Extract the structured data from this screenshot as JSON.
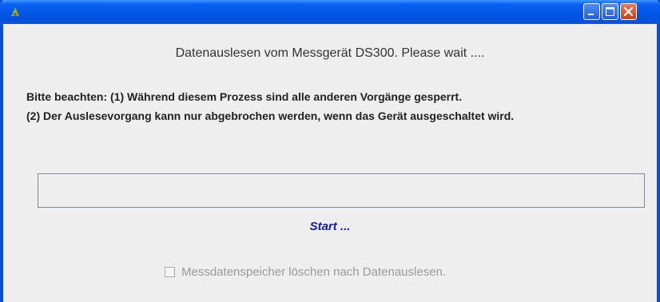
{
  "window": {
    "title": "",
    "icon": "java-app-icon",
    "controls": [
      "minimize-icon",
      "maximize-icon",
      "close-icon"
    ]
  },
  "dialog": {
    "message": "Datenauslesen vom Messgerät DS300. Please wait ....",
    "notice_line1": "Bitte beachten: (1) Während diesem Prozess sind alle anderen Vorgänge gesperrt.",
    "notice_line2": "(2) Der Auslesevorgang kann nur abgebrochen werden, wenn das Gerät ausgeschaltet wird.",
    "progress_fraction": 0,
    "status": "Start ...",
    "checkbox_label": "Messdatenspeicher löschen nach Datenauslesen.",
    "checkbox_checked": false,
    "checkbox_enabled": false
  },
  "colors": {
    "titlebar": "#0456e6",
    "status_text": "#1a1aa8",
    "disabled_text": "#9a9a9a"
  }
}
